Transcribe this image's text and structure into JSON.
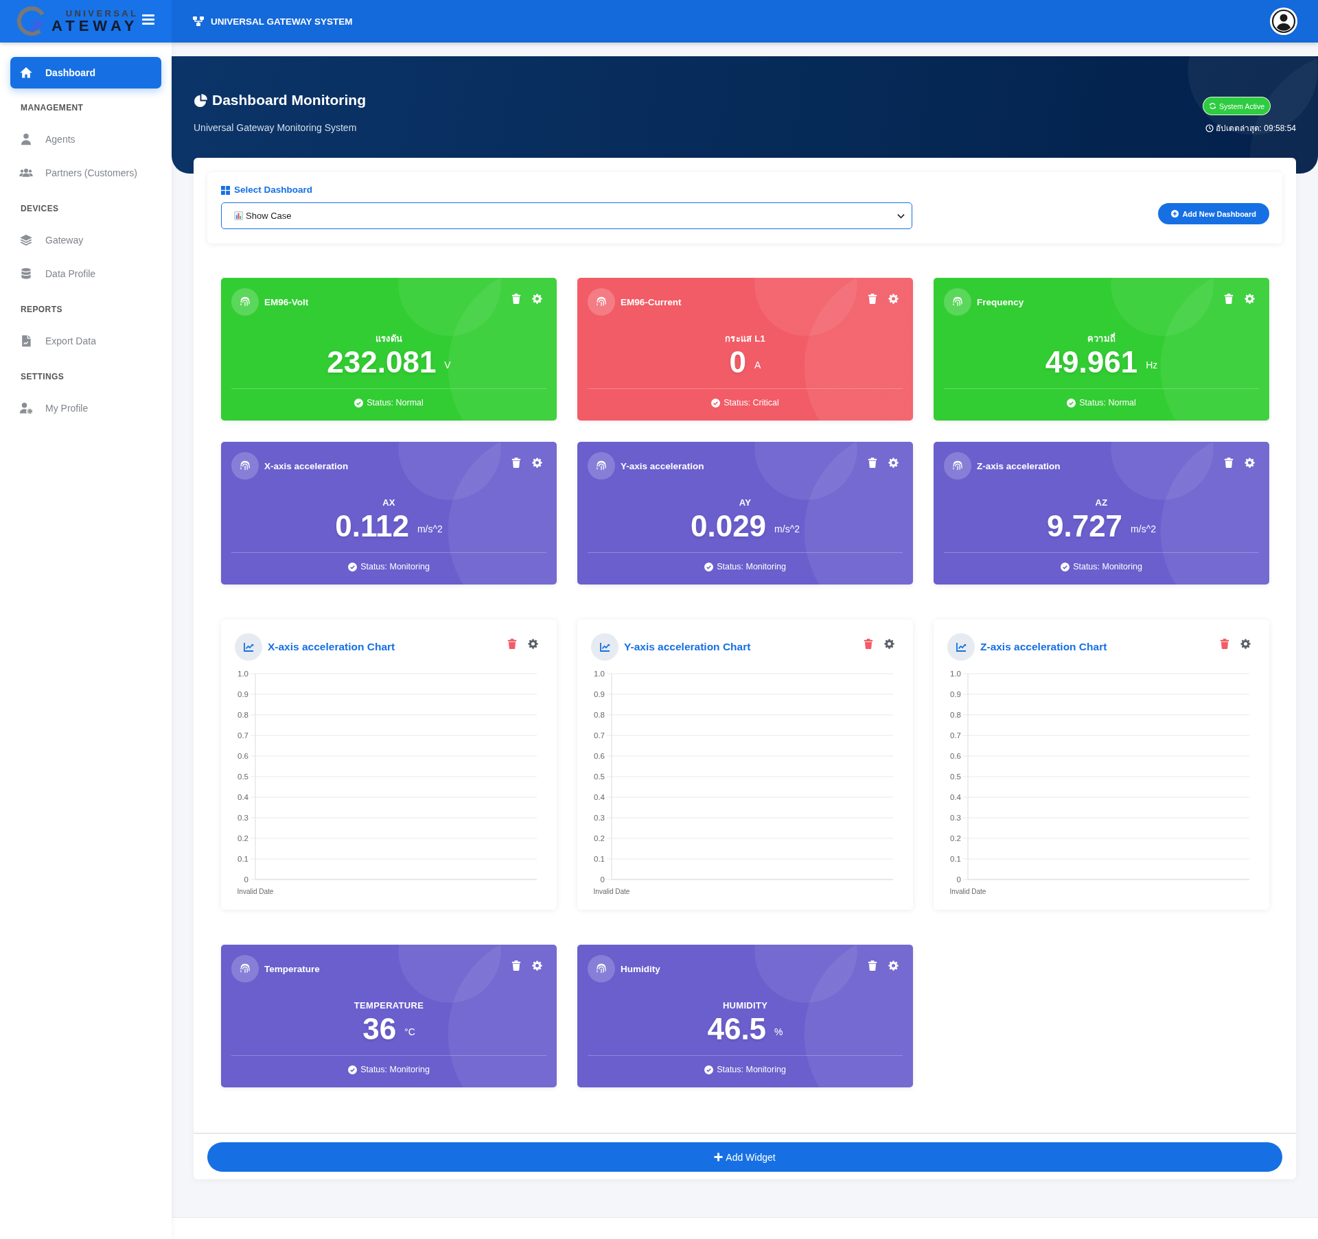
{
  "topbar": {
    "logo": {
      "line_1": "UNIVERSAL",
      "line_2": "ATEWAY"
    },
    "title": "UNIVERSAL GATEWAY SYSTEM"
  },
  "sidebar": {
    "items": [
      {
        "label": "Dashboard",
        "selected": true
      }
    ],
    "sections": [
      {
        "title": "MANAGEMENT",
        "items": [
          {
            "label": "Agents",
            "selected": false
          },
          {
            "label": "Partners (Customers)",
            "selected": false
          }
        ]
      },
      {
        "title": "DEVICES",
        "items": [
          {
            "label": "Gateway",
            "selected": false
          },
          {
            "label": "Data Profile",
            "selected": false
          }
        ]
      },
      {
        "title": "REPORTS",
        "items": [
          {
            "label": "Export Data",
            "selected": false
          }
        ]
      },
      {
        "title": "SETTINGS",
        "items": [
          {
            "label": "My Profile",
            "selected": false
          }
        ]
      }
    ]
  },
  "header": {
    "title": "Dashboard Monitoring",
    "subtitle": "Universal Gateway Monitoring System",
    "status_badge": "System Active",
    "last_updated": "อัปเดตล่าสุด: 09:58:54"
  },
  "dashboard_selector": {
    "label": "Select Dashboard",
    "value": "Show Case",
    "add_button": "Add New Dashboard"
  },
  "widgets": [
    {
      "kind": "value",
      "title": "EM96-Volt",
      "label": "แรงดัน",
      "value": "232.081",
      "unit": "V",
      "status": "Status: Normal",
      "color": "#32cd32"
    },
    {
      "kind": "value",
      "title": "EM96-Current",
      "label": "กระแส L1",
      "value": "0",
      "unit": "A",
      "status": "Status: Critical",
      "color": "#f25c66"
    },
    {
      "kind": "value",
      "title": "Frequency",
      "label": "ความถี่",
      "value": "49.961",
      "unit": "Hz",
      "status": "Status: Normal",
      "color": "#32cd32"
    },
    {
      "kind": "value",
      "title": "X-axis acceleration",
      "label": "AX",
      "value": "0.112",
      "unit": "m/s^2",
      "status": "Status: Monitoring",
      "color": "#6a5fcd"
    },
    {
      "kind": "value",
      "title": "Y-axis acceleration",
      "label": "AY",
      "value": "0.029",
      "unit": "m/s^2",
      "status": "Status: Monitoring",
      "color": "#6a5fcd"
    },
    {
      "kind": "value",
      "title": "Z-axis acceleration",
      "label": "AZ",
      "value": "9.727",
      "unit": "m/s^2",
      "status": "Status: Monitoring",
      "color": "#6a5fcd"
    },
    {
      "kind": "chart",
      "title": "X-axis acceleration Chart",
      "y_axis_labels": [
        "1.0",
        "0.9",
        "0.8",
        "0.7",
        "0.6",
        "0.5",
        "0.4",
        "0.3",
        "0.2",
        "0.1",
        "0"
      ],
      "x_axis_labels": [
        "Invalid Date"
      ]
    },
    {
      "kind": "chart",
      "title": "Y-axis acceleration Chart",
      "y_axis_labels": [
        "1.0",
        "0.9",
        "0.8",
        "0.7",
        "0.6",
        "0.5",
        "0.4",
        "0.3",
        "0.2",
        "0.1",
        "0"
      ],
      "x_axis_labels": [
        "Invalid Date"
      ]
    },
    {
      "kind": "chart",
      "title": "Z-axis acceleration Chart",
      "y_axis_labels": [
        "1.0",
        "0.9",
        "0.8",
        "0.7",
        "0.6",
        "0.5",
        "0.4",
        "0.3",
        "0.2",
        "0.1",
        "0"
      ],
      "x_axis_labels": [
        "Invalid Date"
      ]
    },
    {
      "kind": "value",
      "title": "Temperature",
      "label": "TEMPERATURE",
      "value": "36",
      "unit": "°C",
      "status": "Status: Monitoring",
      "color": "#6a5fcd"
    },
    {
      "kind": "value",
      "title": "Humidity",
      "label": "HUMIDITY",
      "value": "46.5",
      "unit": "%",
      "status": "Status: Monitoring",
      "color": "#6a5fcd"
    }
  ],
  "add_widget_button": "Add Widget"
}
